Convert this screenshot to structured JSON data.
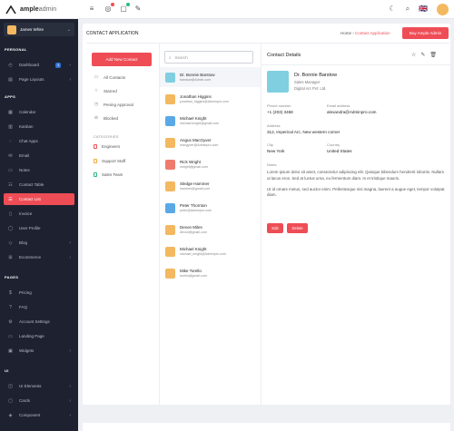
{
  "brand": {
    "name_bold": "ample",
    "name_light": "admin",
    "accent": "#ef4d56"
  },
  "topbar": {
    "icons": [
      "menu-icon",
      "notification-icon",
      "message-icon",
      "brush-icon",
      "moon-icon",
      "search-icon",
      "flag-icon"
    ],
    "flag": "🇬🇧"
  },
  "sidebar": {
    "user": "James White",
    "sections": [
      "PERSONAL",
      "APPS",
      "PAGES",
      "UI"
    ],
    "personal": [
      {
        "label": "Dashboard",
        "icon": "dashboard-icon",
        "badge": "6"
      },
      {
        "label": "Page Layouts",
        "icon": "layout-icon"
      }
    ],
    "apps": [
      {
        "label": "Calendar",
        "icon": "calendar-icon"
      },
      {
        "label": "Kanban",
        "icon": "kanban-icon"
      },
      {
        "label": "Chat Apps",
        "icon": "chat-icon"
      },
      {
        "label": "Email",
        "icon": "email-icon"
      },
      {
        "label": "Notes",
        "icon": "notes-icon"
      },
      {
        "label": "Contact Table",
        "icon": "table-icon"
      },
      {
        "label": "Contact List",
        "icon": "contact-icon"
      },
      {
        "label": "Invoice",
        "icon": "invoice-icon"
      },
      {
        "label": "User Profile",
        "icon": "user-icon"
      },
      {
        "label": "Blog",
        "icon": "blog-icon"
      },
      {
        "label": "Ecommerce",
        "icon": "cart-icon"
      }
    ],
    "pages": [
      {
        "label": "Pricing",
        "icon": "pricing-icon"
      },
      {
        "label": "FAQ",
        "icon": "faq-icon"
      },
      {
        "label": "Account Settings",
        "icon": "settings-icon"
      },
      {
        "label": "Landing Page",
        "icon": "landing-icon"
      },
      {
        "label": "Widgets",
        "icon": "widgets-icon"
      }
    ],
    "ui": [
      {
        "label": "UI Elements",
        "icon": "ui-icon"
      },
      {
        "label": "Cards",
        "icon": "cards-icon"
      },
      {
        "label": "Component",
        "icon": "component-icon"
      }
    ]
  },
  "page": {
    "title": "CONTACT APPLICATION",
    "crumb_home": "Home",
    "crumb_sep": "›",
    "crumb_current": "Contact Application",
    "buy": "Buy Ample Admin"
  },
  "filters": {
    "add": "Add New Contact",
    "items": [
      "All Contacts",
      "Starred",
      "Pening Approval",
      "Blocked"
    ],
    "cat_head": "CATEGORIES",
    "categories": [
      {
        "label": "Engineers",
        "color": "#ef4d56"
      },
      {
        "label": "Support Staff",
        "color": "#f2a93b"
      },
      {
        "label": "Sales Team",
        "color": "#2db87d"
      }
    ]
  },
  "search": {
    "placeholder": "Search"
  },
  "contacts": [
    {
      "name": "Dr. Bonnie Barstow",
      "email": "barstow@Admin.com",
      "color": "#7fcfe0"
    },
    {
      "name": "Jonathan Higgins",
      "email": "jonathan_higgins@Adminpro.com",
      "color": "#f4b860"
    },
    {
      "name": "Michael Knight",
      "email": "michael.knight@gmail.com",
      "color": "#5aa9e6"
    },
    {
      "name": "Angus MacGyver",
      "email": "macgyver@Adminpro.com",
      "color": "#f4b860"
    },
    {
      "name": "Rick Wright",
      "email": "rwright@gmail.com",
      "color": "#ef7b6c"
    },
    {
      "name": "Sledge Hammer",
      "email": "hammer@gmail.com",
      "color": "#f4b860"
    },
    {
      "name": "Peter Thornton",
      "email": "peter@Adminpro.com",
      "color": "#5aa9e6"
    },
    {
      "name": "Devon Miles",
      "email": "devon@gmail.com",
      "color": "#f4b860"
    },
    {
      "name": "Michael Knight",
      "email": "michael_knight@Adminpro.com",
      "color": "#f4b860"
    },
    {
      "name": "Mike Torello",
      "email": "torello@gmail.com",
      "color": "#f4b860"
    }
  ],
  "details": {
    "title": "Contact Details",
    "name": "Dr. Bonnie Barstow",
    "role": "Sales Manager",
    "company": "Digital Arc Pvt. Ltd.",
    "phone_label": "Phone number",
    "phone": "+1 (203) 3458",
    "email_label": "Email address",
    "email": "alexandra@Adminpro.com",
    "address_label": "Address",
    "address": "312, Imperical Arc, New western corner",
    "city_label": "City",
    "city": "New York",
    "country_label": "Country",
    "country": "United States",
    "notes_label": "Notes",
    "notes1": "Lorem ipsum dolor sit amet, consectetur adipiscing elit. Quisque bibendum hendrerit lobortis. Nullam ut lacus eros. Sed at luctus urna, eu fermentum diam. In et tristique mauris.",
    "notes2": "Ut id ornare metus, sed auctor enim. Pellentesque nisi magna, laoreet a augue eget, tempor volutpat diam.",
    "edit": "Edit",
    "delete": "Delete"
  }
}
